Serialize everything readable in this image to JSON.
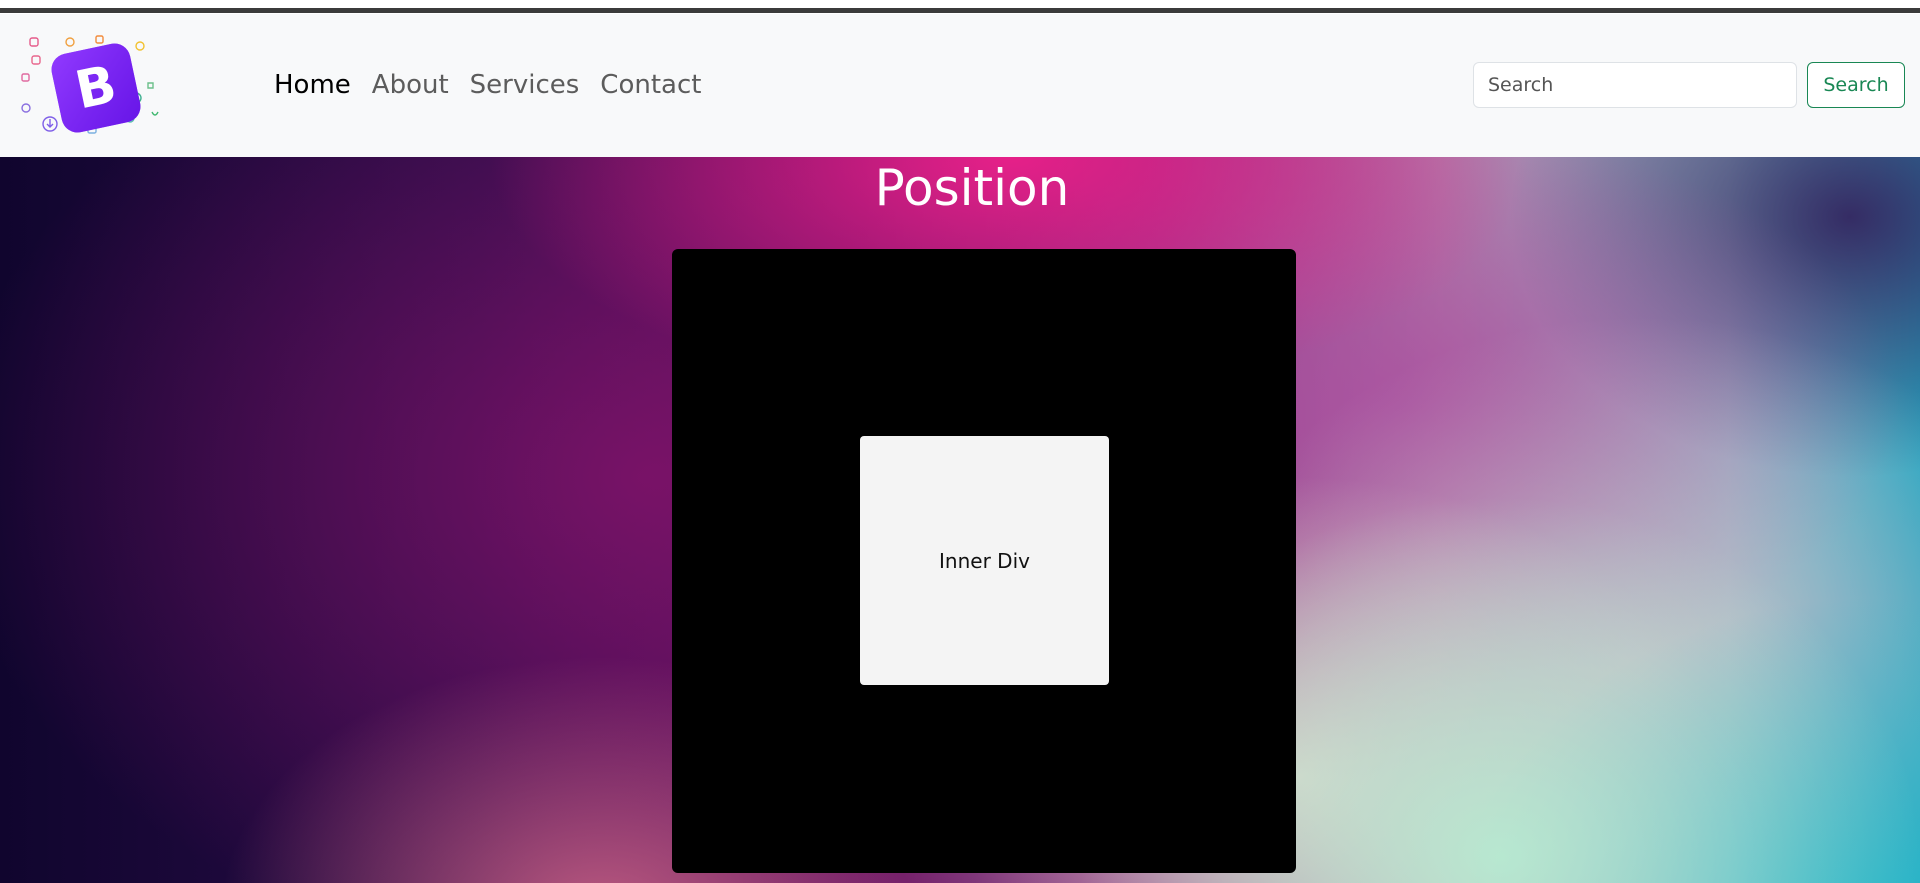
{
  "nav": {
    "links": [
      {
        "label": "Home",
        "active": true
      },
      {
        "label": "About",
        "active": false
      },
      {
        "label": "Services",
        "active": false
      },
      {
        "label": "Contact",
        "active": false
      }
    ],
    "search": {
      "placeholder": "Search",
      "button_label": "Search"
    },
    "logo_letter": "B"
  },
  "main": {
    "title": "Position",
    "inner_label": "Inner Div"
  },
  "colors": {
    "accent_green": "#198754",
    "logo_purple": "#7b1fff"
  },
  "icons": [
    "bootstrap-logo-icon"
  ]
}
